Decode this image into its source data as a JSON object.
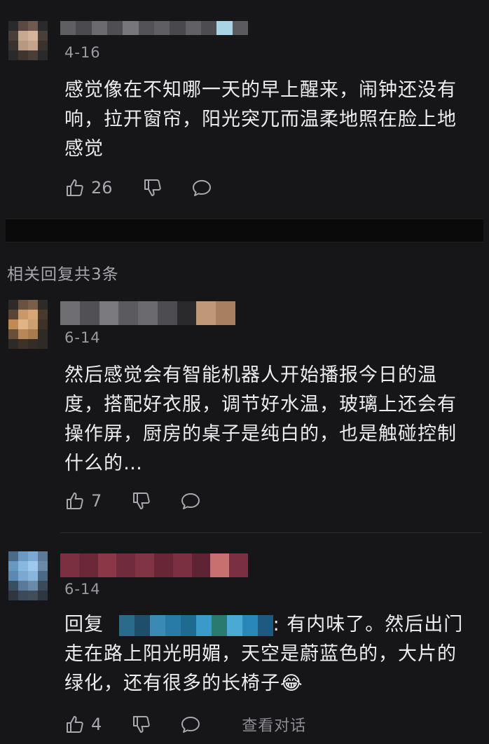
{
  "comments": [
    {
      "date": "4-16",
      "text": "感觉像在不知哪一天的早上醒来，闹钟还没有响，拉开窗帘，阳光突兀而温柔地照在脸上地感觉",
      "likes": "26"
    }
  ],
  "replies_section": {
    "label": "相关回复共3条"
  },
  "replies": [
    {
      "date": "6-14",
      "text": "然后感觉会有智能机器人开始播报今日的温度，搭配好衣服，调节好水温，玻璃上还会有操作屏，厨房的桌子是纯白的，也是触碰控制什么的…",
      "likes": "7"
    },
    {
      "date": "6-14",
      "reply_prefix": "回复",
      "text_after_name": ": 有内味了。然后出门走在路上阳光明媚，天空是蔚蓝色的，大片的绿化，还有很多的长椅子",
      "emoji": "😂",
      "likes": "4",
      "view_conversation": "查看对话"
    }
  ],
  "icons": [
    "thumbs-up-icon",
    "thumbs-down-icon",
    "comment-bubble-icon"
  ]
}
